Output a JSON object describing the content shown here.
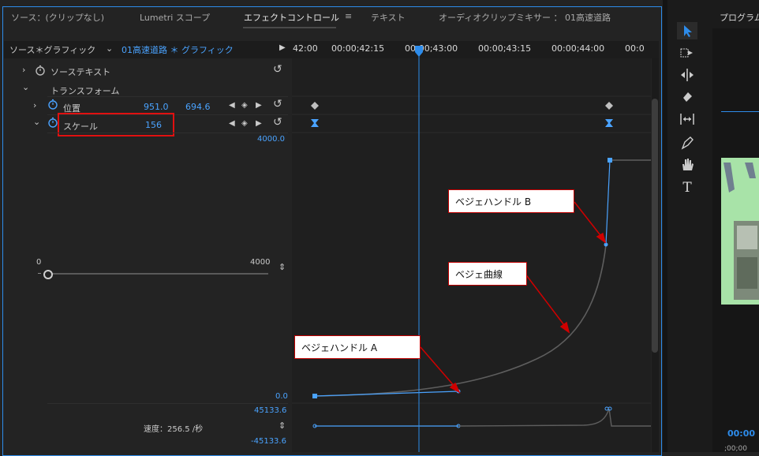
{
  "tabs": {
    "source": "ソース：(クリップなし)",
    "lumetri": "Lumetri スコープ",
    "effect_controls": "エフェクトコントロール",
    "effect_controls_menu": "≡",
    "text": "テキスト",
    "audio_mixer": "オーディオクリップミキサー ： 01高速道路"
  },
  "context": {
    "master": "ソース＊グラフィック",
    "clip": "01高速道路 ＊ グラフィック",
    "chevron": "⌄",
    "play": "▶"
  },
  "timecodes": [
    "42:00",
    "00:00;42:15",
    "00:00;43:00",
    "00:00;43:15",
    "00:00;44:00",
    "00:0"
  ],
  "properties": {
    "source_text": "ソーステキスト",
    "transform": "トランスフォーム",
    "position_label": "位置",
    "position_x": "951.0",
    "position_y": "694.6",
    "scale_label": "スケール",
    "scale_value": "156",
    "value_max": "4000.0",
    "value_min": "0.0",
    "slider_min": "0",
    "slider_max": "4000",
    "velocity_max": "45133.6",
    "velocity_label": "速度：256.5 /秒",
    "velocity_min": "-45133.6"
  },
  "callouts": {
    "handle_b": "ベジェハンドル B",
    "curve": "ベジェ曲線",
    "handle_a": "ベジェハンドル A"
  },
  "program": {
    "title": "プログラム",
    "timecode": "00:00",
    "timecode_small": ";00;00"
  },
  "tools": [
    "selection-tool",
    "track-select-tool",
    "ripple-edit-tool",
    "razor-tool",
    "slip-tool",
    "pen-tool",
    "hand-tool",
    "type-tool"
  ],
  "colors": {
    "accent": "#2d8ceb",
    "callout_border": "#c00000",
    "highlight": "#e01010",
    "curve": "#5a5a5a"
  }
}
